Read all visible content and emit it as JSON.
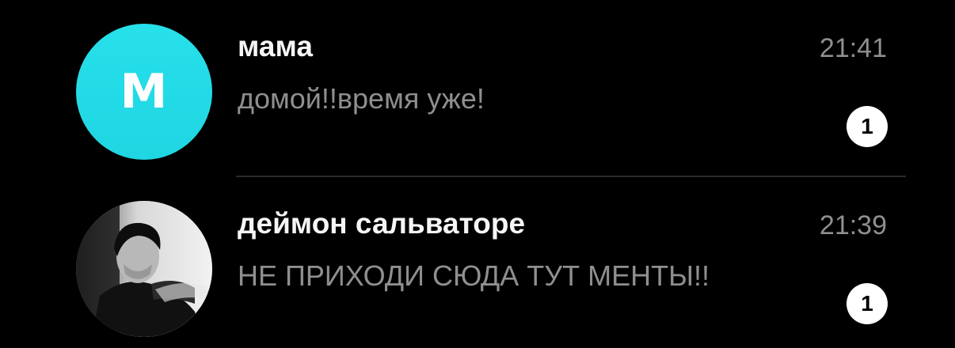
{
  "chats": [
    {
      "avatar_letter": "M",
      "avatar_color": "#22dbe6",
      "name": "мама",
      "preview": "домой!!время уже!",
      "time": "21:41",
      "unread": "1"
    },
    {
      "avatar_letter": "",
      "name": "деймон сальваторе",
      "preview": "НЕ ПРИХОДИ СЮДА ТУТ МЕНТЫ!!",
      "time": "21:39",
      "unread": "1"
    }
  ],
  "colors": {
    "background": "#000000",
    "name_text": "#f5f5f5",
    "secondary_text": "#8f8f8f",
    "badge_bg": "#ffffff",
    "badge_text": "#000000",
    "divider": "#2a2a2a"
  }
}
